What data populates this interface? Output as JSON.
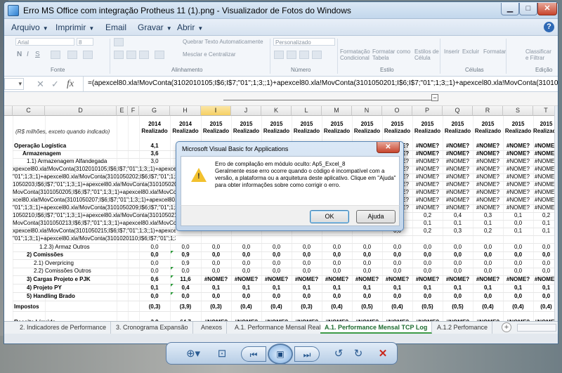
{
  "window": {
    "title": "Erro MS Office com integração Protheus 11 (1).png - Visualizador de Fotos do Windows",
    "minimize": "▁",
    "maximize": "□",
    "close": "✕"
  },
  "menu": {
    "items": [
      "Arquivo",
      "Imprimir",
      "Email",
      "Gravar",
      "Abrir"
    ],
    "help": "?"
  },
  "ribbon": {
    "font_name": "Arial",
    "font_size": "8",
    "wrap_text": "Quebrar Texto Automaticamente",
    "merge_center": "Mesclar e Centralizar",
    "number_format": "Personalizado",
    "cond_format": "Formatação\nCondicional",
    "format_table": "Formatar como\nTabela",
    "cell_styles": "Estilos de\nCélula",
    "insert": "Inserir",
    "delete": "Excluir",
    "format": "Formatar",
    "sort_filter": "Classificar\ne Filtrar",
    "groups": [
      "Fonte",
      "Alinhamento",
      "Número",
      "Estilo",
      "Células",
      "Edição"
    ]
  },
  "formula_bar": {
    "name_box": "",
    "formula": "=(apexcel80.xla!MovConta(3102010105;I$6;I$7;\"01\";1;3;;1)+apexcel80.xla!MovConta(3101050201;I$6;I$7;\"01\";1;3;;1)+apexcel80.xla!MovConta(3101050202;I$6;I$7;\"01\";1;3;;1)"
  },
  "columns": [
    "C",
    "D",
    "E",
    "F",
    "G",
    "H",
    "I",
    "J",
    "K",
    "L",
    "M",
    "N",
    "O",
    "P",
    "Q",
    "R",
    "S",
    "T"
  ],
  "sheet": {
    "note": "(R$ milhões, exceto quando indicado)",
    "years": [
      "2014",
      "2014",
      "2015",
      "2015",
      "2015",
      "2015",
      "2015",
      "2015",
      "2015",
      "2015",
      "2015",
      "2015",
      "2015",
      "2015"
    ],
    "realizado": "Realizado",
    "rows": [
      {
        "label": "Operação Logística",
        "values": [
          "4,1",
          "42"
        ],
        "bold": true
      },
      {
        "label": "Armazenagem",
        "values": [
          "3,6",
          "3,6"
        ],
        "bold": true
      },
      {
        "label": "1.1) Armazenagem Alfandegada",
        "values": [
          "3,0",
          ""
        ]
      },
      {
        "label": "xpexcel80.xla!MovConta(3102010105;I$6;I$7;\"01\";1;3;;1)+apexcel80.xla!MovConta",
        "values": [
          "",
          ""
        ]
      },
      {
        "label": "\"01\";1;3;;1)+apexcel80.xla!MovConta(3101050202;I$6;I$7;\"01\";1;3;;1)+",
        "values": [
          "",
          ""
        ]
      },
      {
        "label": "1050203;I$6;I$7;\"01\";1;3;;1)+apexcel80.xla!MovConta(3101050204;I$6;I$7;\"01",
        "values": [
          "",
          ""
        ]
      },
      {
        "label": "MovConta(3101050205;I$6;I$7;\"01\";1;3;;1)+apexcel80.xla!MovConta(3101050206;I$6",
        "values": [
          "",
          ""
        ]
      },
      {
        "label": "xcel80.xla!MovConta(3101050207;I$6;I$7;\"01\";1;3;;1)+apexcel80.xla!MovConta(31",
        "values": [
          "",
          ""
        ]
      },
      {
        "label": "\"01\";1;3;;1)+apexcel80.xla!MovConta(3101050209;I$6;I$7;\"01\";1;3;;1)+",
        "values": [
          "",
          ""
        ]
      },
      {
        "label": "1050210;I$6;I$7;\"01\";1;3;;1)+apexcel80.xla!MovConta(3101050212;I$6;I$7;\"01",
        "values": [
          "",
          ""
        ]
      },
      {
        "label": "MovConta(3101050213;I$6;I$7;\"01\";1;3;;1)+apexcel80.xla!MovConta(3101050214;I$6",
        "values": [
          "",
          ""
        ]
      },
      {
        "label": "xpexcel80.xla!MovConta(3101050215;I$6;I$7;\"01\";1;3;;1)+apexcel80.xla!MovConta(",
        "values": [
          "",
          ""
        ]
      },
      {
        "label": "\"01\";1;3;;1)+apexcel80.xla!MovConta(3101020110;I$6;I$7;\"01\";1;3;;1)",
        "values": [
          "",
          ""
        ]
      },
      {
        "label": "1.2.3) Armaz Outros",
        "values": [
          "0,0",
          "0,0"
        ]
      },
      {
        "label": "2) Comissões",
        "values": [
          "0,0",
          "0,9"
        ],
        "bold": true
      },
      {
        "label": "2.1) Overpricing",
        "values": [
          "0,0",
          "0,9"
        ]
      },
      {
        "label": "2.2) Comissões Outros",
        "values": [
          "0,0",
          "0,0"
        ]
      },
      {
        "label": "3) Cargas Projeto e PJK",
        "values": [
          "0,6",
          "11,6"
        ],
        "bold": true
      },
      {
        "label": "4) Projeto PY",
        "values": [
          "0,1",
          "0,4"
        ],
        "bold": true
      },
      {
        "label": "5) Handling Brado",
        "values": [
          "0,0",
          "0,0"
        ],
        "bold": true
      },
      {
        "label": "Impostos",
        "values": [
          "(0,3)",
          "(3,9)"
        ],
        "bold": true
      },
      {
        "label": "Receita Líquida",
        "values": [
          "3,9",
          "64,7"
        ],
        "bold": true
      }
    ],
    "right_values": {
      "r1": [
        "#NOME?",
        "#NOME?",
        "#NOME?",
        "#NOME?",
        "#NOME?",
        "#NOME?"
      ],
      "p_q_r_s_rows9_12": [
        [
          "0,2",
          "0,4",
          "0,3",
          "0,1",
          "0,2"
        ],
        [
          "0,1",
          "0,1",
          "0,1",
          "0,0",
          "0,1"
        ],
        [
          "0,2",
          "0,3",
          "0,2",
          "0,1",
          "0,1"
        ]
      ],
      "zeros": "0,0",
      "nome": "#NOME?",
      "projeto_py": "0,1",
      "impostos": [
        "(0,3)",
        "(0,4)",
        "(0,4)",
        "(0,3)",
        "(0,4)",
        "(0,5)",
        "(0,4)",
        "(0,5)",
        "(0,5)",
        "(0,4)",
        "(0,4)",
        "(0,4)"
      ]
    }
  },
  "tabs": {
    "items": [
      "2. Indicadores de Performance",
      "3. Cronograma Expansão",
      "Anexos",
      "A.1. Performance Mensal Real",
      "A.1. Performance Mensal TCP Log",
      "A.1.2 Perfomance"
    ],
    "active_index": 4,
    "add": "+"
  },
  "dialog": {
    "title": "Microsoft Visual Basic for Applications",
    "close": "✕",
    "message": "Erro de compilação em módulo oculto: Ap5_Excel_8\nGeralmente esse erro ocorre quando o código é incompatível com a versão, a plataforma ou a arquitetura deste aplicativo. Clique em \"Ajuda\" para obter informações sobre como corrigir o erro.",
    "ok": "OK",
    "help": "Ajuda"
  },
  "viewer_toolbar": {
    "zoom": "⊕▾",
    "fit": "⊡",
    "prev": "⏮",
    "slideshow": "▣",
    "next": "⏭",
    "rotate_left": "↺",
    "rotate_right": "↻",
    "delete": "✕"
  }
}
